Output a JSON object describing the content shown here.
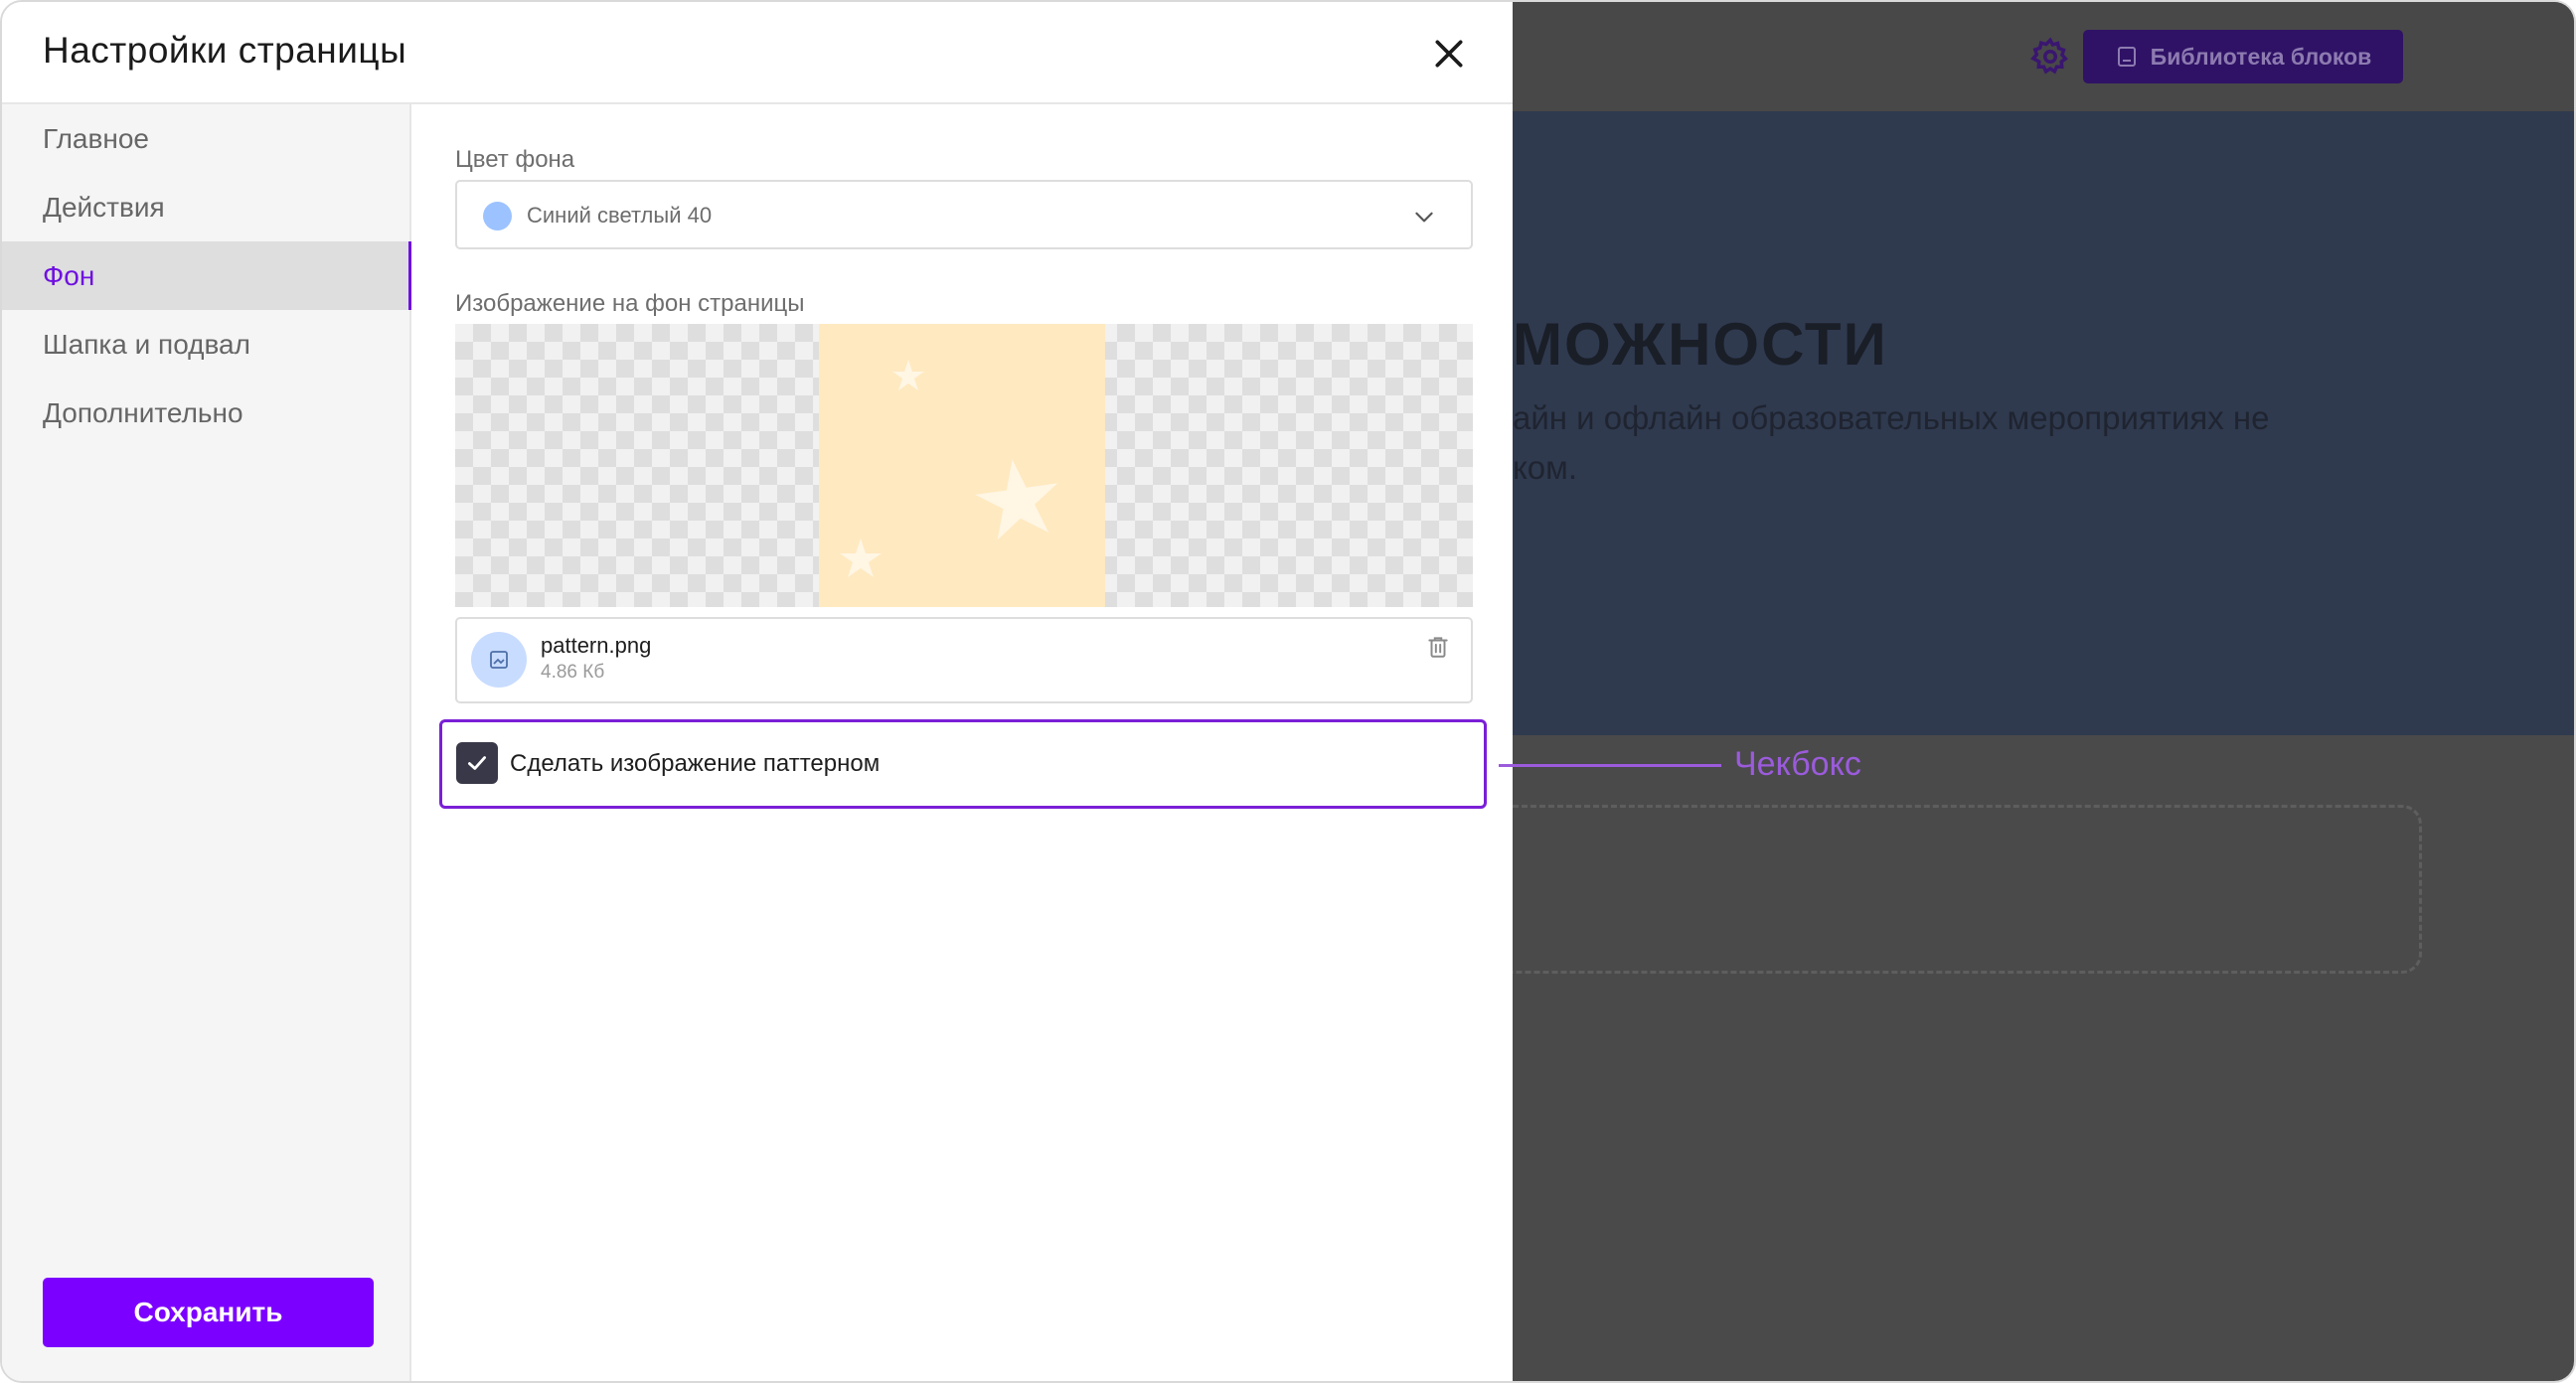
{
  "modal": {
    "title": "Настройки страницы",
    "close_icon": "close-icon"
  },
  "sidebar": {
    "items": [
      {
        "label": "Главное",
        "active": false
      },
      {
        "label": "Действия",
        "active": false
      },
      {
        "label": "Фон",
        "active": true
      },
      {
        "label": "Шапка и подвал",
        "active": false
      },
      {
        "label": "Дополнительно",
        "active": false
      }
    ],
    "save_label": "Сохранить"
  },
  "background": {
    "color_label": "Цвет фона",
    "color_value": "Синий светлый 40",
    "color_swatch": "#9cc2ff",
    "image_label": "Изображение на фон страницы",
    "file": {
      "name": "pattern.png",
      "size": "4.86 Кб"
    },
    "pattern_checkbox": {
      "label": "Сделать изображение паттерном",
      "checked": true
    }
  },
  "editor": {
    "library_button": "Библиотека блоков",
    "hero_title": "МОЖНОСТИ",
    "hero_line_1": "айн и офлайн образовательных мероприятиях не",
    "hero_line_2": "ком."
  },
  "annotation": {
    "label": "Чекбокс"
  },
  "colors": {
    "accent": "#7c00ff",
    "active_nav": "#6f10e0",
    "highlight": "#7a1fd6",
    "callout": "#9b5bdc"
  }
}
